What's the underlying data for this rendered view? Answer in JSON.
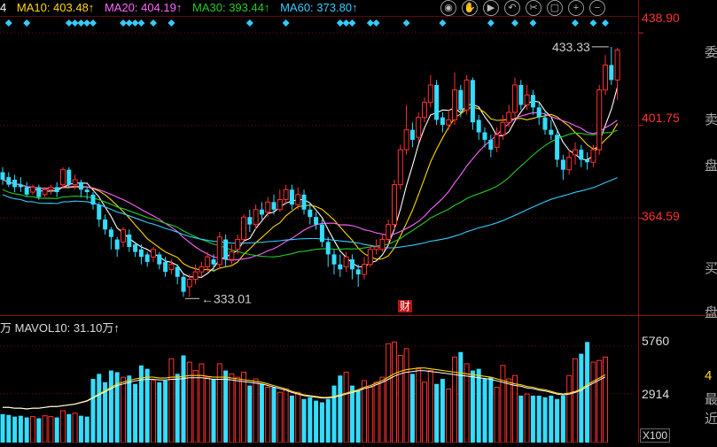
{
  "legend": {
    "items": [
      {
        "text": "4",
        "color": "#ffffff"
      },
      {
        "text": "MA10: 403.48↑",
        "color": "#ffd700"
      },
      {
        "text": "MA20: 404.19↑",
        "color": "#ff66ff"
      },
      {
        "text": "MA30: 393.44↑",
        "color": "#22cc22"
      },
      {
        "text": "MA60: 373.80↑",
        "color": "#33ccff"
      }
    ]
  },
  "toolbar": [
    "eye-icon",
    "hand-icon",
    "play-icon",
    "undo-icon",
    "scissors-icon",
    "lock-icon",
    "zoom-in-icon",
    "zoom-out-icon"
  ],
  "side_labels": [
    "委",
    "卖",
    "盘",
    "买",
    "盘"
  ],
  "side_labels_volume": [
    "4",
    "最",
    "近"
  ],
  "volume_legend": {
    "prefix": "万",
    "text": "MAVOL10: 31.10万↑"
  },
  "volume_x_label": "X100",
  "news_badge": "财",
  "colors": {
    "up": "#ff3030",
    "down": "#33ddff",
    "ma5": "#ffffff",
    "ma10": "#ffd700",
    "ma20": "#ff66ff",
    "ma30": "#22cc22",
    "ma60": "#33ccff"
  },
  "chart_data": {
    "type": "candlestick",
    "price_axis": {
      "ticks": [
        438.9,
        401.75,
        364.59
      ],
      "ylim": [
        326,
        445
      ]
    },
    "volume_axis": {
      "ticks": [
        5760,
        2914
      ],
      "ylim": [
        0,
        6600
      ]
    },
    "annotations": {
      "max": "433.33",
      "min": "333.01"
    },
    "candles": [
      {
        "o": 383,
        "c": 380,
        "h": 385,
        "l": 378
      },
      {
        "o": 381,
        "c": 378,
        "h": 383,
        "l": 377
      },
      {
        "o": 380,
        "c": 377,
        "h": 382,
        "l": 375
      },
      {
        "o": 378,
        "c": 377,
        "h": 381,
        "l": 375
      },
      {
        "o": 377,
        "c": 374,
        "h": 379,
        "l": 373
      },
      {
        "o": 375,
        "c": 377,
        "h": 378,
        "l": 374
      },
      {
        "o": 377,
        "c": 373,
        "h": 378,
        "l": 372
      },
      {
        "o": 374,
        "c": 376,
        "h": 377,
        "l": 373
      },
      {
        "o": 376,
        "c": 377,
        "h": 378,
        "l": 374
      },
      {
        "o": 377,
        "c": 375,
        "h": 379,
        "l": 373
      },
      {
        "o": 378,
        "c": 384,
        "h": 385,
        "l": 377
      },
      {
        "o": 384,
        "c": 378,
        "h": 385,
        "l": 377
      },
      {
        "o": 378,
        "c": 380,
        "h": 382,
        "l": 376
      },
      {
        "o": 379,
        "c": 376,
        "h": 380,
        "l": 373
      },
      {
        "o": 376,
        "c": 375,
        "h": 377,
        "l": 372
      },
      {
        "o": 374,
        "c": 370,
        "h": 375,
        "l": 368
      },
      {
        "o": 370,
        "c": 364,
        "h": 371,
        "l": 361
      },
      {
        "o": 364,
        "c": 360,
        "h": 366,
        "l": 358
      },
      {
        "o": 360,
        "c": 357,
        "h": 361,
        "l": 352
      },
      {
        "o": 356,
        "c": 352,
        "h": 357,
        "l": 349
      },
      {
        "o": 355,
        "c": 360,
        "h": 361,
        "l": 353
      },
      {
        "o": 358,
        "c": 353,
        "h": 360,
        "l": 351
      },
      {
        "o": 354,
        "c": 351,
        "h": 355,
        "l": 349
      },
      {
        "o": 352,
        "c": 349,
        "h": 354,
        "l": 346
      },
      {
        "o": 350,
        "c": 347,
        "h": 351,
        "l": 345
      },
      {
        "o": 349,
        "c": 352,
        "h": 353,
        "l": 347
      },
      {
        "o": 350,
        "c": 346,
        "h": 351,
        "l": 344
      },
      {
        "o": 347,
        "c": 343,
        "h": 349,
        "l": 341
      },
      {
        "o": 344,
        "c": 346,
        "h": 348,
        "l": 342
      },
      {
        "o": 345,
        "c": 341,
        "h": 346,
        "l": 338
      },
      {
        "o": 341,
        "c": 335,
        "h": 342,
        "l": 333
      },
      {
        "o": 337,
        "c": 340,
        "h": 342,
        "l": 333
      },
      {
        "o": 340,
        "c": 343,
        "h": 346,
        "l": 338
      },
      {
        "o": 343,
        "c": 345,
        "h": 347,
        "l": 341
      },
      {
        "o": 345,
        "c": 349,
        "h": 351,
        "l": 343
      },
      {
        "o": 348,
        "c": 346,
        "h": 350,
        "l": 343
      },
      {
        "o": 346,
        "c": 357,
        "h": 359,
        "l": 344
      },
      {
        "o": 356,
        "c": 348,
        "h": 358,
        "l": 345
      },
      {
        "o": 348,
        "c": 351,
        "h": 354,
        "l": 346
      },
      {
        "o": 352,
        "c": 356,
        "h": 358,
        "l": 350
      },
      {
        "o": 356,
        "c": 365,
        "h": 366,
        "l": 354
      },
      {
        "o": 365,
        "c": 362,
        "h": 368,
        "l": 359
      },
      {
        "o": 362,
        "c": 368,
        "h": 370,
        "l": 360
      },
      {
        "o": 368,
        "c": 366,
        "h": 371,
        "l": 364
      },
      {
        "o": 367,
        "c": 371,
        "h": 373,
        "l": 365
      },
      {
        "o": 371,
        "c": 368,
        "h": 374,
        "l": 366
      },
      {
        "o": 368,
        "c": 372,
        "h": 376,
        "l": 367
      },
      {
        "o": 372,
        "c": 376,
        "h": 378,
        "l": 370
      },
      {
        "o": 376,
        "c": 370,
        "h": 378,
        "l": 368
      },
      {
        "o": 370,
        "c": 374,
        "h": 377,
        "l": 368
      },
      {
        "o": 374,
        "c": 368,
        "h": 376,
        "l": 366
      },
      {
        "o": 368,
        "c": 365,
        "h": 371,
        "l": 362
      },
      {
        "o": 365,
        "c": 362,
        "h": 367,
        "l": 360
      },
      {
        "o": 362,
        "c": 355,
        "h": 364,
        "l": 353
      },
      {
        "o": 355,
        "c": 350,
        "h": 357,
        "l": 345
      },
      {
        "o": 350,
        "c": 346,
        "h": 352,
        "l": 342
      },
      {
        "o": 346,
        "c": 344,
        "h": 350,
        "l": 341
      },
      {
        "o": 345,
        "c": 349,
        "h": 351,
        "l": 343
      },
      {
        "o": 348,
        "c": 344,
        "h": 350,
        "l": 340
      },
      {
        "o": 344,
        "c": 342,
        "h": 346,
        "l": 337
      },
      {
        "o": 342,
        "c": 346,
        "h": 349,
        "l": 340
      },
      {
        "o": 346,
        "c": 352,
        "h": 354,
        "l": 345
      },
      {
        "o": 352,
        "c": 353,
        "h": 356,
        "l": 350
      },
      {
        "o": 352,
        "c": 356,
        "h": 358,
        "l": 351
      },
      {
        "o": 356,
        "c": 362,
        "h": 364,
        "l": 354
      },
      {
        "o": 362,
        "c": 378,
        "h": 380,
        "l": 360
      },
      {
        "o": 378,
        "c": 392,
        "h": 394,
        "l": 376
      },
      {
        "o": 392,
        "c": 400,
        "h": 410,
        "l": 390
      },
      {
        "o": 400,
        "c": 396,
        "h": 403,
        "l": 393
      },
      {
        "o": 397,
        "c": 405,
        "h": 407,
        "l": 395
      },
      {
        "o": 405,
        "c": 411,
        "h": 413,
        "l": 403
      },
      {
        "o": 411,
        "c": 418,
        "h": 422,
        "l": 409
      },
      {
        "o": 418,
        "c": 404,
        "h": 420,
        "l": 402
      },
      {
        "o": 405,
        "c": 402,
        "h": 407,
        "l": 399
      },
      {
        "o": 402,
        "c": 404,
        "h": 408,
        "l": 400
      },
      {
        "o": 404,
        "c": 416,
        "h": 423,
        "l": 402
      },
      {
        "o": 416,
        "c": 408,
        "h": 418,
        "l": 405
      },
      {
        "o": 408,
        "c": 420,
        "h": 422,
        "l": 406
      },
      {
        "o": 420,
        "c": 403,
        "h": 421,
        "l": 400
      },
      {
        "o": 404,
        "c": 399,
        "h": 406,
        "l": 396
      },
      {
        "o": 399,
        "c": 396,
        "h": 401,
        "l": 393
      },
      {
        "o": 396,
        "c": 392,
        "h": 398,
        "l": 389
      },
      {
        "o": 393,
        "c": 398,
        "h": 401,
        "l": 391
      },
      {
        "o": 398,
        "c": 403,
        "h": 406,
        "l": 396
      },
      {
        "o": 403,
        "c": 407,
        "h": 410,
        "l": 401
      },
      {
        "o": 407,
        "c": 418,
        "h": 421,
        "l": 405
      },
      {
        "o": 418,
        "c": 410,
        "h": 420,
        "l": 408
      },
      {
        "o": 410,
        "c": 414,
        "h": 418,
        "l": 408
      },
      {
        "o": 414,
        "c": 409,
        "h": 416,
        "l": 406
      },
      {
        "o": 409,
        "c": 405,
        "h": 411,
        "l": 402
      },
      {
        "o": 405,
        "c": 400,
        "h": 407,
        "l": 398
      },
      {
        "o": 400,
        "c": 398,
        "h": 404,
        "l": 396
      },
      {
        "o": 398,
        "c": 388,
        "h": 400,
        "l": 385
      },
      {
        "o": 388,
        "c": 384,
        "h": 390,
        "l": 380
      },
      {
        "o": 384,
        "c": 389,
        "h": 392,
        "l": 382
      },
      {
        "o": 390,
        "c": 392,
        "h": 395,
        "l": 386
      },
      {
        "o": 392,
        "c": 388,
        "h": 394,
        "l": 385
      },
      {
        "o": 388,
        "c": 387,
        "h": 391,
        "l": 384
      },
      {
        "o": 387,
        "c": 392,
        "h": 394,
        "l": 385
      },
      {
        "o": 392,
        "c": 416,
        "h": 418,
        "l": 390
      },
      {
        "o": 416,
        "c": 426,
        "h": 430,
        "l": 414
      },
      {
        "o": 426,
        "c": 420,
        "h": 433.33,
        "l": 418
      },
      {
        "o": 420,
        "c": 432,
        "h": 433,
        "l": 412
      }
    ],
    "volume": [
      1700,
      1650,
      1550,
      1600,
      1500,
      1550,
      1450,
      1600,
      1550,
      1500,
      1900,
      1700,
      1750,
      1600,
      1550,
      3800,
      4100,
      3600,
      4300,
      4200,
      3900,
      4000,
      3500,
      4600,
      4400,
      3700,
      3600,
      3700,
      5000,
      4100,
      5200,
      4800,
      4300,
      4700,
      3900,
      3800,
      4700,
      4300,
      4100,
      3900,
      4200,
      3400,
      3800,
      3500,
      3300,
      3300,
      3000,
      3200,
      2800,
      3000,
      2600,
      2700,
      2500,
      2400,
      2600,
      3400,
      4000,
      4200,
      3400,
      3100,
      3700,
      3300,
      3600,
      3900,
      5900,
      6000,
      5200,
      5600,
      4100,
      4400,
      3600,
      4300,
      3500,
      3800,
      3200,
      5100,
      5400,
      4700,
      4300,
      4400,
      3800,
      3900,
      3300,
      4600,
      3800,
      4000,
      2800,
      2900,
      2800,
      2800,
      2700,
      2800,
      2600,
      2800,
      4000,
      5000,
      5300,
      6000,
      4800,
      4900,
      5100
    ],
    "volume_ma": [
      2100,
      2100,
      2050,
      2050,
      2000,
      2050,
      2050,
      2100,
      2150,
      2150,
      2200,
      2250,
      2300,
      2400,
      2500,
      2700,
      2900,
      3100,
      3300,
      3500,
      3600,
      3700,
      3800,
      3850,
      3900,
      3900,
      3850,
      3850,
      3900,
      3900,
      3950,
      4000,
      4000,
      4000,
      3950,
      3900,
      3900,
      3900,
      3850,
      3800,
      3750,
      3700,
      3650,
      3600,
      3500,
      3400,
      3300,
      3200,
      3050,
      2950,
      2850,
      2800,
      2750,
      2700,
      2700,
      2750,
      2850,
      2950,
      3050,
      3150,
      3300,
      3400,
      3550,
      3700,
      3900,
      4100,
      4250,
      4350,
      4400,
      4450,
      4450,
      4400,
      4350,
      4300,
      4250,
      4200,
      4150,
      4100,
      4050,
      4000,
      3950,
      3900,
      3800,
      3700,
      3600,
      3500,
      3450,
      3350,
      3300,
      3200,
      3150,
      3050,
      2950,
      2900,
      2950,
      3050,
      3200,
      3450,
      3650,
      3850,
      4050
    ]
  }
}
